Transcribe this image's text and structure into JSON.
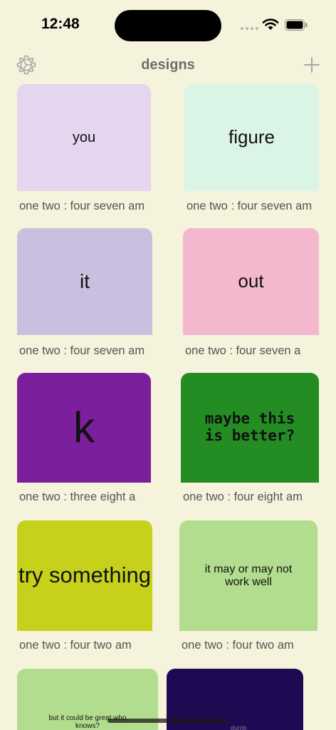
{
  "status": {
    "time": "12:48"
  },
  "nav": {
    "title": "designs",
    "settings_icon": "gear-icon",
    "add_icon": "plus-icon"
  },
  "colors": {
    "background": "#f5f3dc"
  },
  "cards": [
    {
      "text": "you",
      "caption": "one two : four seven  am",
      "bg": "#e5d5ef"
    },
    {
      "text": "figure",
      "caption": "one two : four seven  am",
      "bg": "#daf5e6"
    },
    {
      "text": "it",
      "caption": "one two : four seven  am",
      "bg": "#cbbfdf"
    },
    {
      "text": "out",
      "caption": "one two : four seven  a",
      "bg": "#f4b8ce"
    },
    {
      "text": "k",
      "caption": "one two : three eight  a",
      "bg": "#7c1f9c"
    },
    {
      "text": "maybe this is better?",
      "caption": "one two : four eight  am",
      "bg": "#238d23"
    },
    {
      "text": "try something",
      "caption": "one two : four two  am",
      "bg": "#c5d11a"
    },
    {
      "text": "it may or may not work well",
      "caption": "one two : four two  am",
      "bg": "#b2dd8e"
    },
    {
      "text": "but it could be great who knows?",
      "caption": "",
      "bg": "#b2dd8e"
    },
    {
      "text": "dumb",
      "caption": "",
      "bg": "#1d0a52"
    }
  ]
}
